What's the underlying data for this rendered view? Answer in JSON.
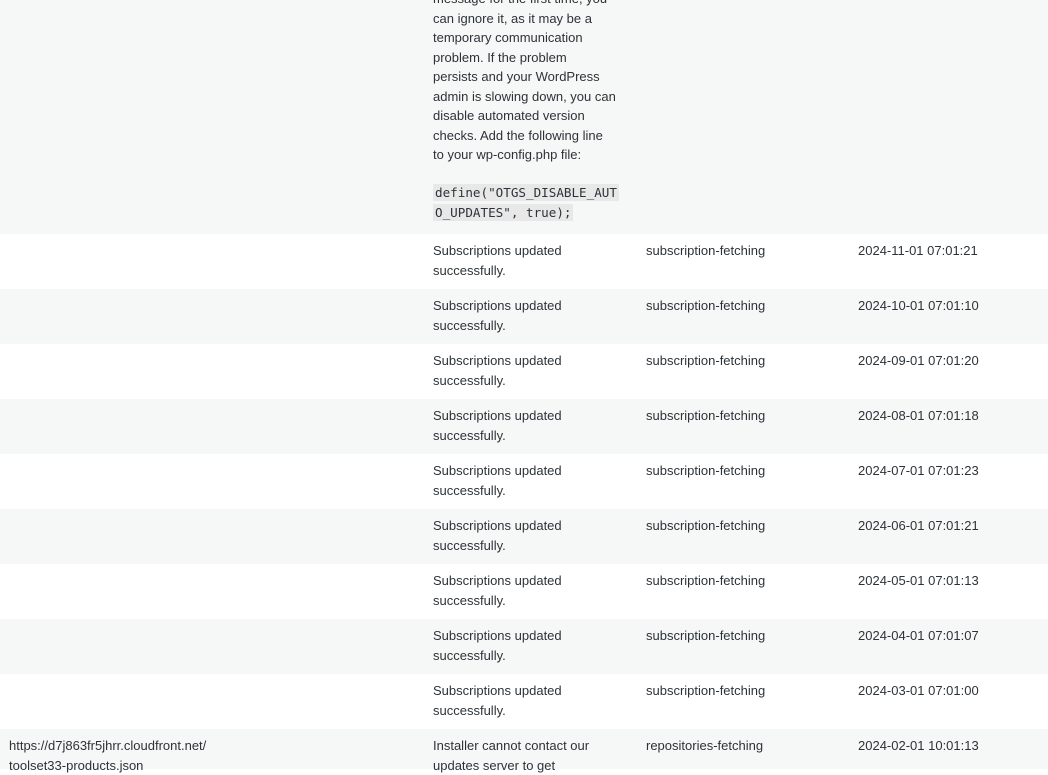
{
  "first_row": {
    "message_lines": [
      "message for the first time, you",
      "can ignore it, as it may be a",
      "temporary communication",
      "problem. If the problem",
      "persists and your WordPress",
      "admin is slowing down, you can",
      "disable automated version",
      "checks. Add the following line",
      "to your wp-config.php file:"
    ],
    "code": "define(\"OTGS_DISABLE_AUTO_UPDATES\", true);"
  },
  "rows": [
    {
      "url": "",
      "message": "Subscriptions updated successfully.",
      "type": "subscription-fetching",
      "time": "2024-11-01 07:01:21"
    },
    {
      "url": "",
      "message": "Subscriptions updated successfully.",
      "type": "subscription-fetching",
      "time": "2024-10-01 07:01:10"
    },
    {
      "url": "",
      "message": "Subscriptions updated successfully.",
      "type": "subscription-fetching",
      "time": "2024-09-01 07:01:20"
    },
    {
      "url": "",
      "message": "Subscriptions updated successfully.",
      "type": "subscription-fetching",
      "time": "2024-08-01 07:01:18"
    },
    {
      "url": "",
      "message": "Subscriptions updated successfully.",
      "type": "subscription-fetching",
      "time": "2024-07-01 07:01:23"
    },
    {
      "url": "",
      "message": "Subscriptions updated successfully.",
      "type": "subscription-fetching",
      "time": "2024-06-01 07:01:21"
    },
    {
      "url": "",
      "message": "Subscriptions updated successfully.",
      "type": "subscription-fetching",
      "time": "2024-05-01 07:01:13"
    },
    {
      "url": "",
      "message": "Subscriptions updated successfully.",
      "type": "subscription-fetching",
      "time": "2024-04-01 07:01:07"
    },
    {
      "url": "",
      "message": "Subscriptions updated successfully.",
      "type": "subscription-fetching",
      "time": "2024-03-01 07:01:00"
    },
    {
      "url": "https://d7j863fr5jhrr.cloudfront.net/toolset33-products.json",
      "message": "Installer cannot contact our updates server to get",
      "type": "repositories-fetching",
      "time": "2024-02-01 10:01:13"
    }
  ]
}
